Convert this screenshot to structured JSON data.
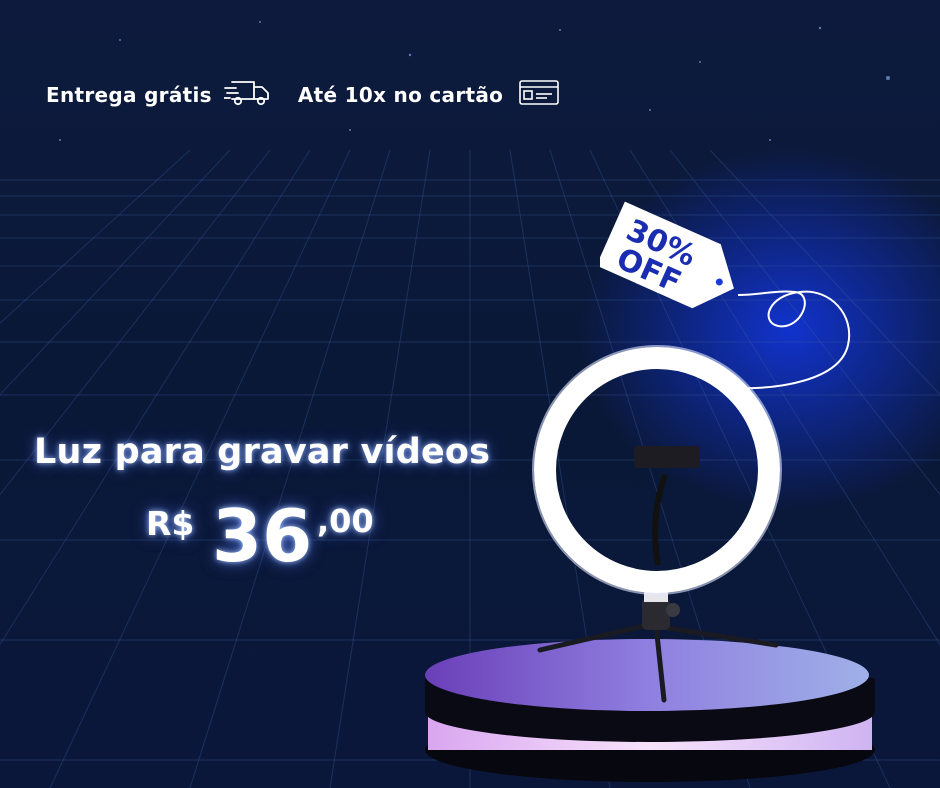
{
  "topbar": {
    "shipping_label": "Entrega grátis",
    "shipping_icon": "delivery-truck-icon",
    "installments_label": "Até 10x no cartão",
    "installments_icon": "credit-card-icon"
  },
  "product": {
    "title": "Luz para gravar vídeos",
    "currency": "R$",
    "price_integer": "36",
    "price_decimal": ",00",
    "image": "ring-light-on-stand-icon"
  },
  "discount": {
    "line1": "30%",
    "line2": "OFF"
  },
  "colors": {
    "background": "#0c1638",
    "glow": "#1438ff",
    "text": "#ffffff",
    "tag_text": "#1a2db0",
    "pedestal_top": "#8a7ad8",
    "pedestal_band": "#f0c8f6"
  }
}
